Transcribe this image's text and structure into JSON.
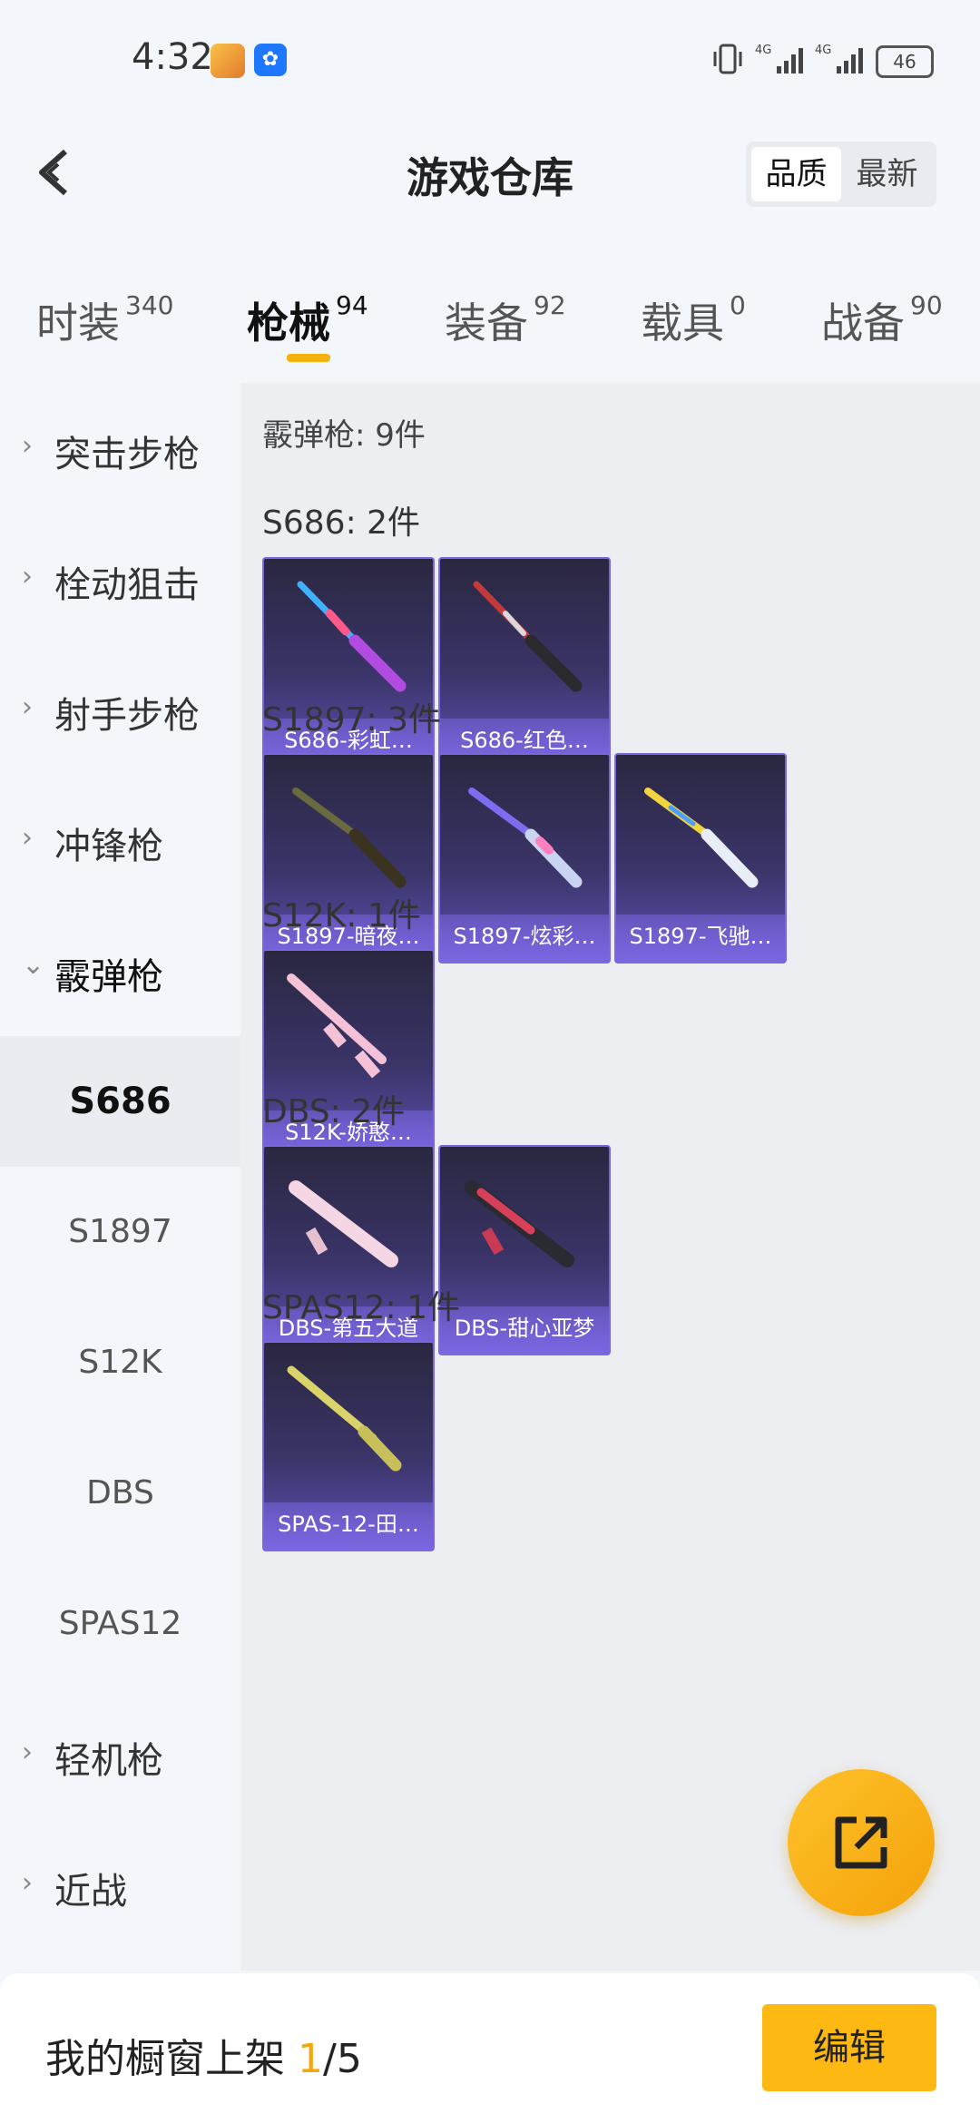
{
  "status_bar": {
    "time": "4:32",
    "battery": "46",
    "network_1": "4G",
    "network_2": "4G",
    "icons": [
      "app-game-icon",
      "app-blue-icon",
      "vibrate-icon",
      "signal-icon",
      "signal-icon",
      "battery-icon"
    ]
  },
  "header": {
    "title": "游戏仓库",
    "sort_options": [
      "品质",
      "最新"
    ],
    "selected_sort": "品质"
  },
  "tabs": [
    {
      "label": "时装",
      "count": "340"
    },
    {
      "label": "枪械",
      "count": "94"
    },
    {
      "label": "装备",
      "count": "92"
    },
    {
      "label": "载具",
      "count": "0"
    },
    {
      "label": "战备",
      "count": "90"
    }
  ],
  "active_tab": "枪械",
  "sidebar": {
    "categories": [
      {
        "label": "突击步枪",
        "expanded": false
      },
      {
        "label": "栓动狙击",
        "expanded": false
      },
      {
        "label": "射手步枪",
        "expanded": false
      },
      {
        "label": "冲锋枪",
        "expanded": false
      },
      {
        "label": "霰弹枪",
        "expanded": true
      },
      {
        "label": "轻机枪",
        "expanded": false
      },
      {
        "label": "近战",
        "expanded": false
      }
    ],
    "sub_items": [
      "S686",
      "S1897",
      "S12K",
      "DBS",
      "SPAS12"
    ],
    "active_sub": "S686"
  },
  "content": {
    "category_title": "霰弹枪: 9件",
    "groups": [
      {
        "title": "S686: 2件",
        "items": [
          "S686-彩虹…",
          "S686-红色…"
        ]
      },
      {
        "title": "S1897: 3件",
        "items": [
          "S1897-暗夜…",
          "S1897-炫彩…",
          "S1897-飞驰…"
        ]
      },
      {
        "title": "S12K: 1件",
        "items": [
          "S12K-娇憨…"
        ]
      },
      {
        "title": "DBS: 2件",
        "items": [
          "DBS-第五大道",
          "DBS-甜心亚梦"
        ]
      },
      {
        "title": "SPAS12: 1件",
        "items": [
          "SPAS-12-田…"
        ]
      }
    ]
  },
  "bottom_bar": {
    "label": "我的橱窗上架",
    "current": "1",
    "total": "/5",
    "edit_label": "编辑"
  },
  "colors": {
    "accent": "#f5b10d",
    "card_border": "#7b67e0",
    "fab": "#ffc22a"
  }
}
